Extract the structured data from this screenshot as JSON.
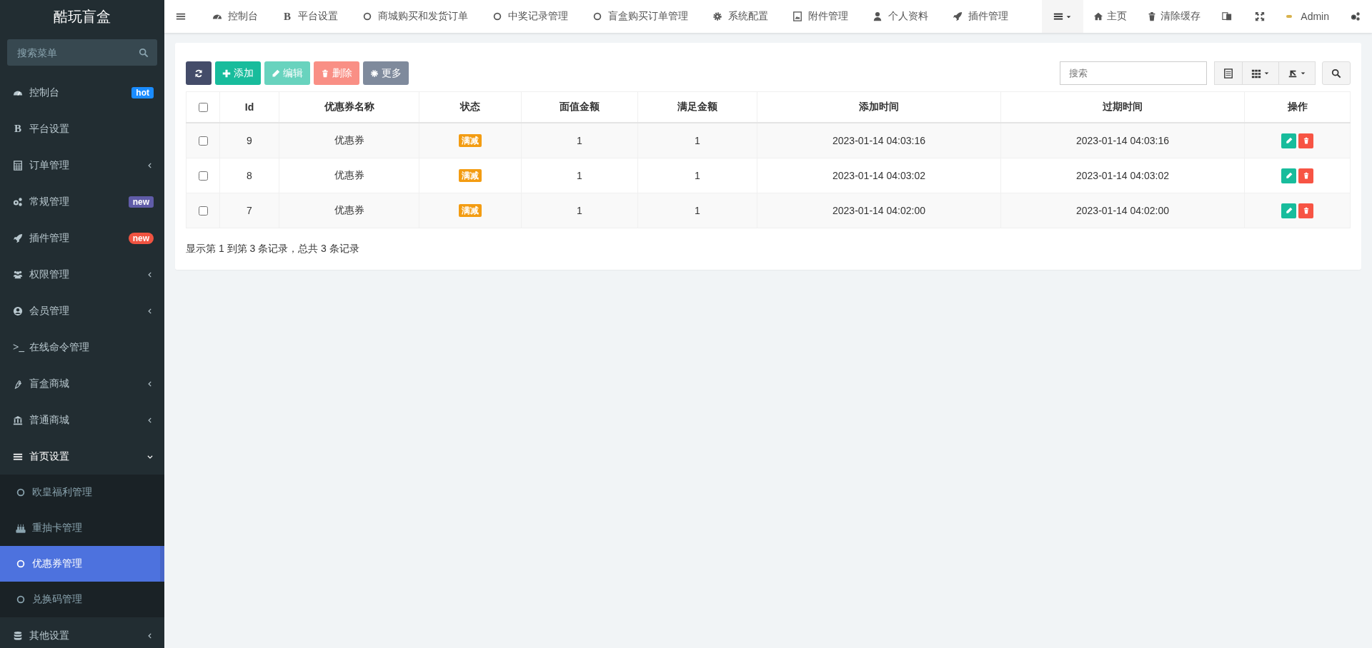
{
  "sidebar": {
    "logo": "酷玩盲盒",
    "search": {
      "placeholder": "搜索菜单"
    },
    "items": [
      {
        "label": "控制台",
        "badge": {
          "text": "hot",
          "color": "#1a8cff",
          "kind": "square"
        }
      },
      {
        "label": "平台设置",
        "glyph": "B"
      },
      {
        "label": "订单管理",
        "expanded": false
      },
      {
        "label": "常规管理",
        "badge": {
          "text": "new",
          "color": "#605ca8",
          "kind": "square"
        }
      },
      {
        "label": "插件管理",
        "badge": {
          "text": "new",
          "color": "#f05341",
          "kind": "pill"
        }
      },
      {
        "label": "权限管理",
        "expanded": false
      },
      {
        "label": "会员管理",
        "expanded": false
      },
      {
        "label": "在线命令管理",
        "glyph": ">_"
      },
      {
        "label": "盲盒商城",
        "expanded": false
      },
      {
        "label": "普通商城",
        "expanded": false
      },
      {
        "label": "首页设置",
        "expanded": true,
        "children": [
          {
            "label": "欧皇福利管理",
            "selected": false
          },
          {
            "label": "重抽卡管理",
            "selected": false
          },
          {
            "label": "优惠券管理",
            "selected": true
          },
          {
            "label": "兑换码管理",
            "selected": false
          }
        ]
      },
      {
        "label": "其他设置",
        "expanded": false
      }
    ]
  },
  "topbar": {
    "tabs": [
      {
        "label": "控制台"
      },
      {
        "label": "平台设置",
        "glyph": "B"
      },
      {
        "label": "商城购买和发货订单"
      },
      {
        "label": "中奖记录管理"
      },
      {
        "label": "盲盒购买订单管理"
      },
      {
        "label": "系统配置"
      },
      {
        "label": "附件管理"
      },
      {
        "label": "个人资料"
      },
      {
        "label": "插件管理"
      }
    ],
    "links": [
      {
        "label": "主页"
      },
      {
        "label": "清除缓存"
      }
    ],
    "user": "Admin"
  },
  "toolbar": {
    "buttons": [
      {
        "kind": "refresh",
        "disabled": false
      },
      {
        "kind": "add",
        "label": "添加",
        "disabled": false
      },
      {
        "kind": "edit",
        "label": "编辑",
        "disabled": true
      },
      {
        "kind": "delete",
        "label": "删除",
        "disabled": true
      },
      {
        "kind": "more",
        "label": "更多",
        "disabled": false
      }
    ],
    "search": {
      "placeholder": "搜索"
    }
  },
  "table": {
    "header_checked": false,
    "columns": [
      "Id",
      "优惠券名称",
      "状态",
      "面值金额",
      "满足金额",
      "添加时间",
      "过期时间",
      "操作"
    ],
    "rows": [
      {
        "checked": false,
        "id": "9",
        "name": "优惠券",
        "status": "满减",
        "face_value": "1",
        "min_amount": "1",
        "added": "2023-01-14 04:03:16",
        "expires": "2023-01-14 04:03:16"
      },
      {
        "checked": false,
        "id": "8",
        "name": "优惠券",
        "status": "满减",
        "face_value": "1",
        "min_amount": "1",
        "added": "2023-01-14 04:03:02",
        "expires": "2023-01-14 04:03:02"
      },
      {
        "checked": false,
        "id": "7",
        "name": "优惠券",
        "status": "满减",
        "face_value": "1",
        "min_amount": "1",
        "added": "2023-01-14 04:02:00",
        "expires": "2023-01-14 04:02:00"
      }
    ]
  },
  "pagination_info": "显示第 1 到第 3 条记录，总共 3 条记录"
}
